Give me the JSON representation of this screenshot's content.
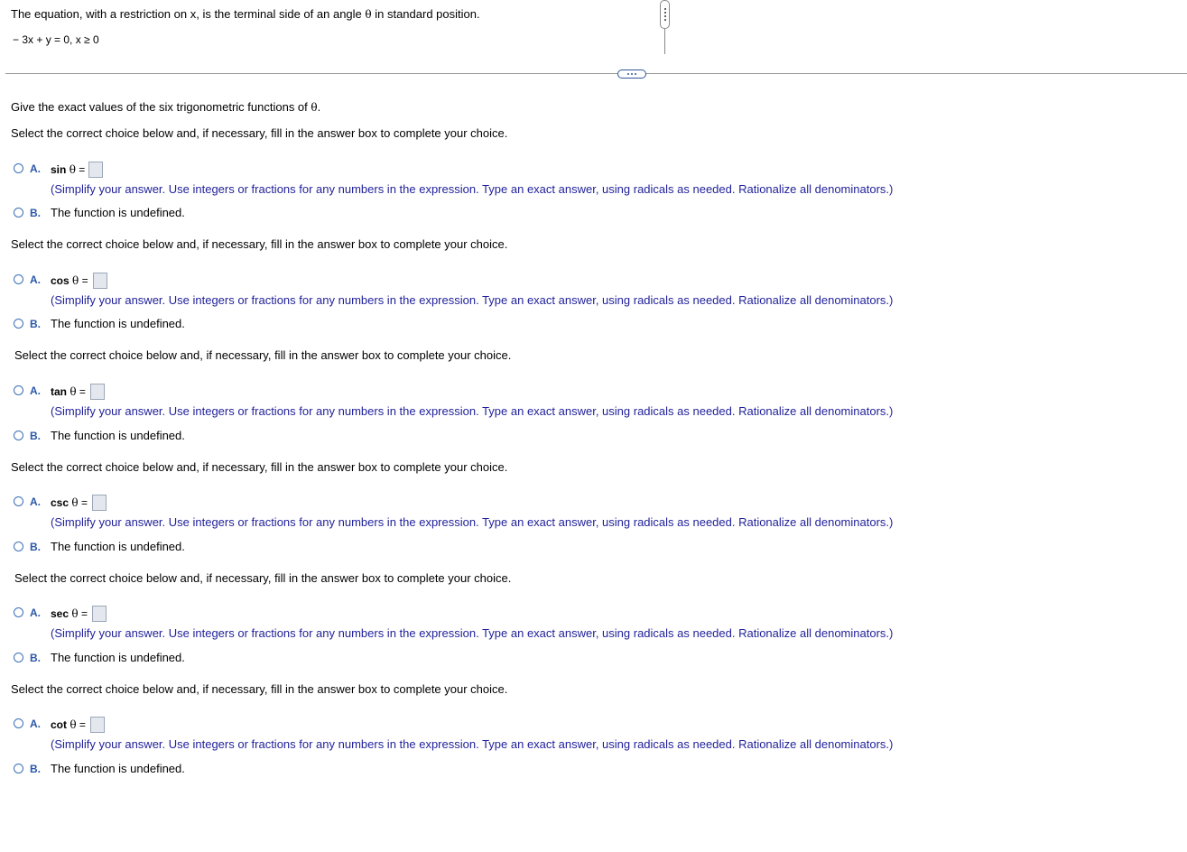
{
  "problem": {
    "statement_before": "The equation, with a restriction on x, is the terminal side of an angle ",
    "theta": "θ",
    "statement_after": " in standard position.",
    "equation": "− 3x + y = 0, x ≥ 0"
  },
  "instruction": {
    "before": "Give the exact values of the six trigonometric functions of ",
    "after": "."
  },
  "select_prompt": "Select the correct choice below and, if necessary, fill in the answer box to complete your choice.",
  "hint_text": "(Simplify your answer. Use integers or fractions for any numbers in the expression. Type an exact answer, using radicals as needed. Rationalize all denominators.)",
  "option_a_letter": "A.",
  "option_b_letter": "B.",
  "undefined_text": "The function is undefined.",
  "equals": " =",
  "functions": [
    {
      "name": "sin"
    },
    {
      "name": "cos"
    },
    {
      "name": "tan"
    },
    {
      "name": "csc"
    },
    {
      "name": "sec"
    },
    {
      "name": "cot"
    }
  ],
  "colors": {
    "option_letter": "#2a57a8",
    "hint": "#1f1f9a",
    "radio_border": "#3b6fb6"
  }
}
